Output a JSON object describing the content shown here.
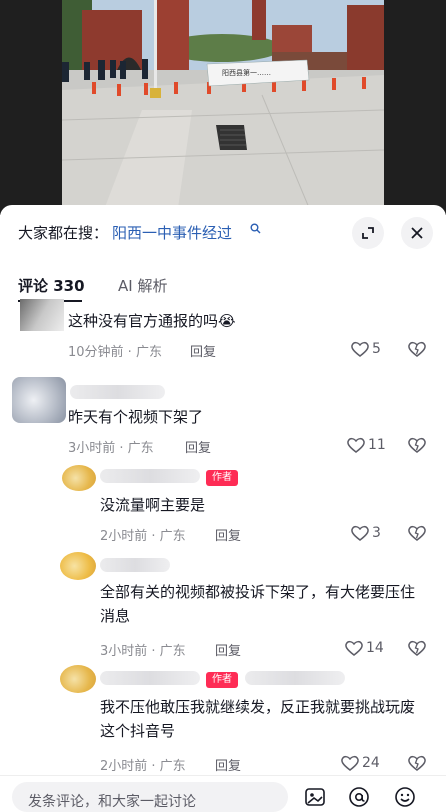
{
  "search": {
    "prefix": "大家都在搜：",
    "query": "阳西一中事件经过"
  },
  "tabs": [
    {
      "label": "评论 330"
    },
    {
      "label": "AI 解析"
    }
  ],
  "banner_text": "阳西县第一……",
  "comments": [
    {
      "text": "这种没有官方通报的吗😭",
      "time": "10分钟前 · 广东",
      "reply": "回复",
      "likes": "5"
    },
    {
      "text": "昨天有个视频下架了",
      "time": "3小时前 · 广东",
      "reply": "回复",
      "likes": "11"
    },
    {
      "text": "没流量啊主要是",
      "time": "2小时前 · 广东",
      "reply": "回复",
      "likes": "3",
      "badge": "作者"
    },
    {
      "text": "全部有关的视频都被投诉下架了，有大佬要压住消息",
      "time": "3小时前 · 广东",
      "reply": "回复",
      "likes": "14"
    },
    {
      "text": "我不压他敢压我就继续发，反正我就要挑战玩废这个抖音号",
      "time": "2小时前 · 广东",
      "reply": "回复",
      "likes": "24",
      "badge": "作者"
    }
  ],
  "input": {
    "placeholder": "发条评论，和大家一起讨论"
  },
  "colors": {
    "accent_red": "#fe2c55",
    "link_blue": "#2b5fb3",
    "meta_gray": "#8a8b91"
  },
  "icons": [
    "expand-icon",
    "close-icon",
    "search-small-icon",
    "heart-icon",
    "dislike-icon",
    "image-icon",
    "at-icon",
    "emoji-icon"
  ]
}
